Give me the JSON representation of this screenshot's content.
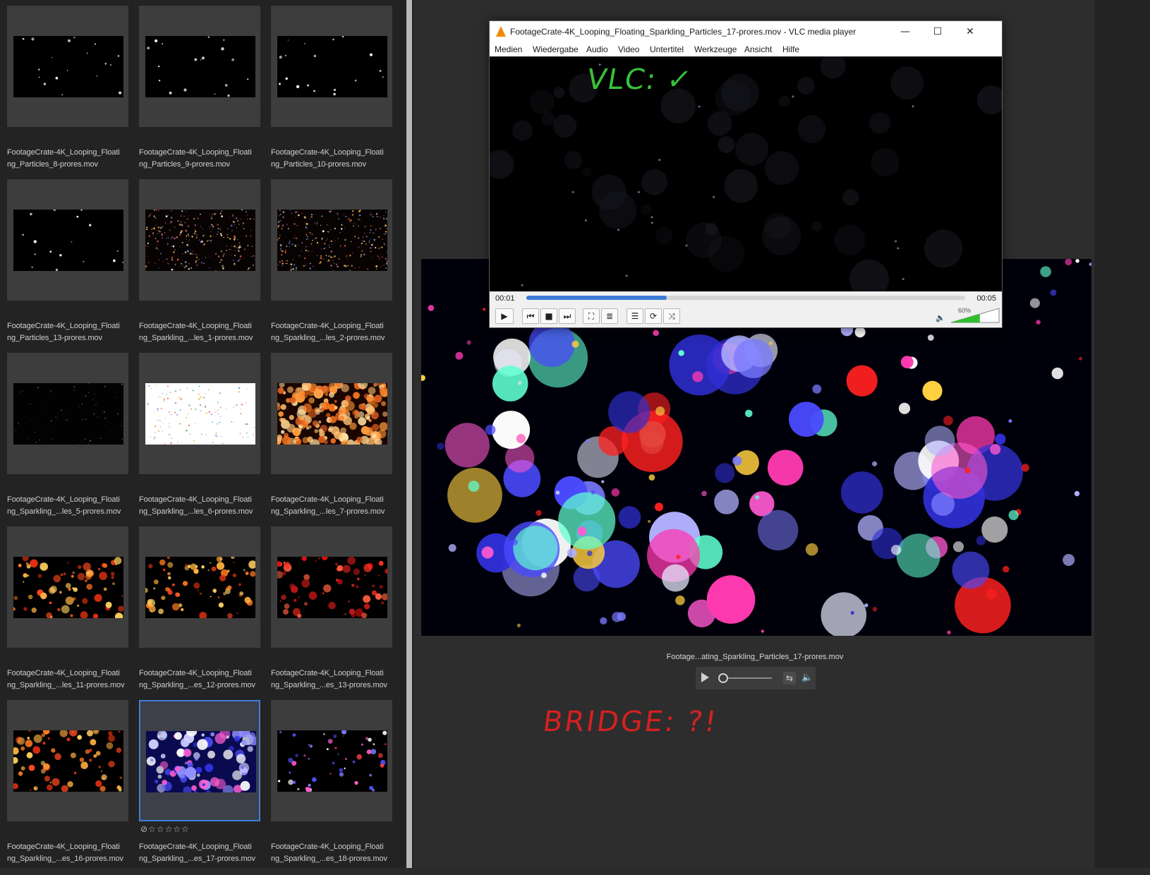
{
  "grid": {
    "thumbnails": [
      {
        "caption": "FootageCrate-4K_Looping_Floati\nng_Particles_8-prores.mov",
        "style": "sparse-white"
      },
      {
        "caption": "FootageCrate-4K_Looping_Floati\nng_Particles_9-prores.mov",
        "style": "sparse-white"
      },
      {
        "caption": "FootageCrate-4K_Looping_Floati\nng_Particles_10-prores.mov",
        "style": "sparse-white"
      },
      {
        "caption": "FootageCrate-4K_Looping_Floati\nng_Particles_13-prores.mov",
        "style": "sparse-white"
      },
      {
        "caption": "FootageCrate-4K_Looping_Floati\nng_Sparkling_...les_1-prores.mov",
        "style": "dense-warm"
      },
      {
        "caption": "FootageCrate-4K_Looping_Floati\nng_Sparkling_...les_2-prores.mov",
        "style": "dense-warm"
      },
      {
        "caption": "FootageCrate-4K_Looping_Floati\nng_Sparkling_...les_5-prores.mov",
        "style": "dark-colorful"
      },
      {
        "caption": "FootageCrate-4K_Looping_Floati\nng_Sparkling_...les_6-prores.mov",
        "style": "white-confetti"
      },
      {
        "caption": "FootageCrate-4K_Looping_Floati\nng_Sparkling_...les_7-prores.mov",
        "style": "orange-fire"
      },
      {
        "caption": "FootageCrate-4K_Looping_Floati\nng_Sparkling_...les_11-prores.mov",
        "style": "orange-bokeh"
      },
      {
        "caption": "FootageCrate-4K_Looping_Floati\nng_Sparkling_...es_12-prores.mov",
        "style": "orange-bokeh"
      },
      {
        "caption": "FootageCrate-4K_Looping_Floati\nng_Sparkling_...es_13-prores.mov",
        "style": "red-bokeh"
      },
      {
        "caption": "FootageCrate-4K_Looping_Floati\nng_Sparkling_...es_16-prores.mov",
        "style": "orange-bokeh"
      },
      {
        "caption": "FootageCrate-4K_Looping_Floati\nng_Sparkling_...es_17-prores.mov",
        "style": "blue-bokeh",
        "selected": true,
        "rating": "⊘☆☆☆☆☆"
      },
      {
        "caption": "FootageCrate-4K_Looping_Floati\nng_Sparkling_...es_18-prores.mov",
        "style": "dark-blue-bokeh"
      }
    ]
  },
  "preview": {
    "filename": "Footage...ating_Sparkling_Particles_17-prores.mov",
    "annotation": "BRIDGE: ?!",
    "controls": {
      "play_icon": "play-icon",
      "loop_icon": "loop-icon",
      "volume_icon": "speaker-icon",
      "position": 0.0
    }
  },
  "vlc": {
    "title": "FootageCrate-4K_Looping_Floating_Sparkling_Particles_17-prores.mov - VLC media player",
    "window_buttons": {
      "minimize": "—",
      "maximize": "☐",
      "close": "✕"
    },
    "menus": [
      "Medien",
      "Wiedergabe",
      "Audio",
      "Video",
      "Untertitel",
      "Werkzeuge",
      "Ansicht",
      "Hilfe"
    ],
    "annotation": "VLC: ✓",
    "time_elapsed": "00:01",
    "time_total": "00:05",
    "progress": 0.32,
    "volume_label": "60%",
    "volume": 0.6,
    "buttons": [
      {
        "icon": "play-icon",
        "glyph": "▶"
      },
      {
        "icon": "previous-icon",
        "glyph": "⏮"
      },
      {
        "icon": "stop-icon",
        "glyph": "■"
      },
      {
        "icon": "next-icon",
        "glyph": "⏭"
      },
      {
        "icon": "fullscreen-icon",
        "glyph": "⛶"
      },
      {
        "icon": "extended-settings-icon",
        "glyph": "≣"
      },
      {
        "icon": "playlist-icon",
        "glyph": "☰"
      },
      {
        "icon": "loop-icon",
        "glyph": "⟳"
      },
      {
        "icon": "shuffle-icon",
        "glyph": "⤨"
      }
    ]
  },
  "colors": {
    "selection": "#3f7fd9",
    "vlc_progress": "#3a7bd5",
    "vlc_note": "#38c23a",
    "bridge_note": "#d62020"
  }
}
